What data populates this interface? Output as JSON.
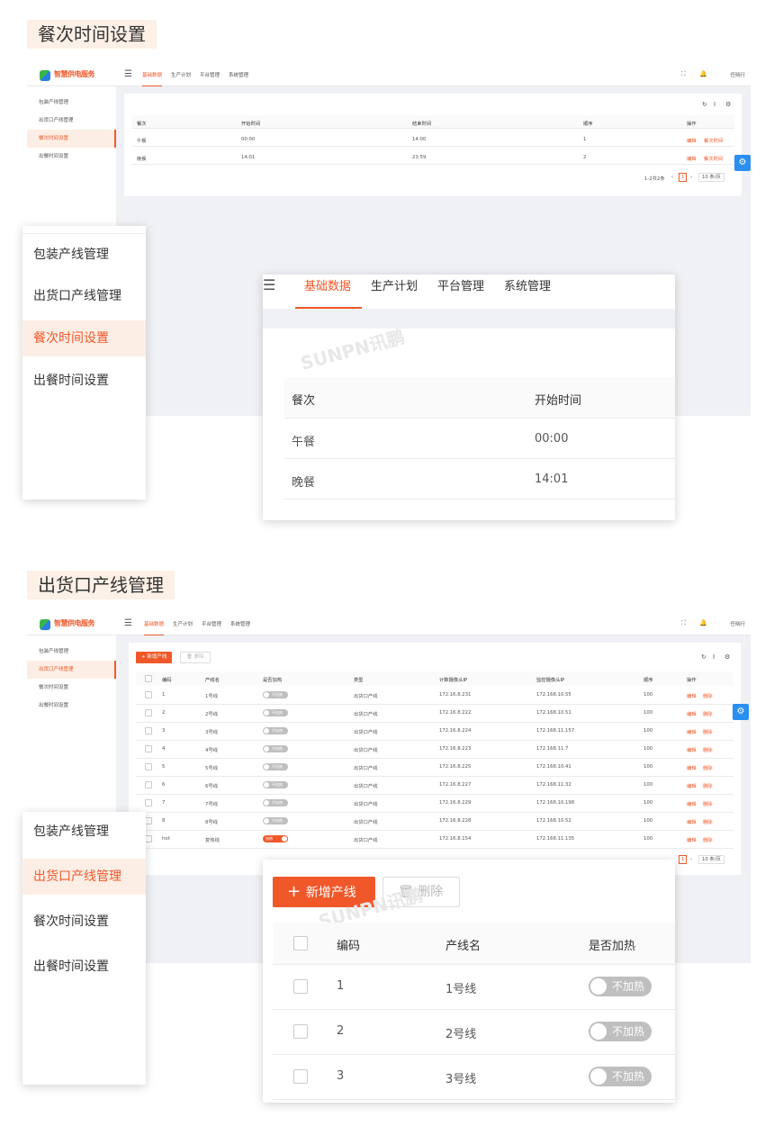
{
  "section1": {
    "title": "餐次时间设置",
    "app": {
      "logo_text": "智慧供电服务",
      "nav": [
        "基础数据",
        "生产计划",
        "平台管理",
        "系统管理"
      ],
      "user": "任晓行",
      "sidebar": [
        "包装产线管理",
        "出货口产线管理",
        "餐次时间设置",
        "出餐时间设置"
      ],
      "table_headers": [
        "餐次",
        "开始时间",
        "结束时间",
        "顺序",
        "操作"
      ],
      "rows": [
        {
          "meal": "午餐",
          "start": "00:00",
          "end": "14:00",
          "order": "1",
          "edit": "编辑",
          "action": "餐次时间"
        },
        {
          "meal": "晚餐",
          "start": "14:01",
          "end": "23:59",
          "order": "2",
          "edit": "编辑",
          "action": "餐次时间"
        }
      ],
      "pagination": {
        "total": "1-2共2条",
        "page": "1",
        "per_page": "10 条/页"
      }
    },
    "zoom_side": [
      "包装产线管理",
      "出货口产线管理",
      "餐次时间设置",
      "出餐时间设置"
    ],
    "zoom_main": {
      "nav": [
        "基础数据",
        "生产计划",
        "平台管理",
        "系统管理"
      ],
      "headers": [
        "餐次",
        "开始时间"
      ],
      "rows": [
        [
          "午餐",
          "00:00"
        ],
        [
          "晚餐",
          "14:01"
        ]
      ],
      "watermark": "SUNPN讯鹏"
    }
  },
  "section2": {
    "title": "出货口产线管理",
    "app": {
      "logo_text": "智慧供电服务",
      "nav": [
        "基础数据",
        "生产计划",
        "平台管理",
        "系统管理"
      ],
      "user": "任晓行",
      "sidebar": [
        "包装产线管理",
        "出货口产线管理",
        "餐次时间设置",
        "出餐时间设置"
      ],
      "add_btn": "新增产线",
      "del_btn": "删除",
      "headers": [
        "编码",
        "产线名",
        "是否加热",
        "类型",
        "计数摄像头IP",
        "监控摄像头IP",
        "顺序",
        "操作"
      ],
      "rows": [
        {
          "code": "1",
          "name": "1号线",
          "heat": "不加热",
          "on": false,
          "type": "出货口产线",
          "cip": "172.16.8.231",
          "mip": "172.168.10.55",
          "order": "100"
        },
        {
          "code": "2",
          "name": "2号线",
          "heat": "不加热",
          "on": false,
          "type": "出货口产线",
          "cip": "172.16.8.222",
          "mip": "172.168.10.51",
          "order": "100"
        },
        {
          "code": "3",
          "name": "3号线",
          "heat": "不加热",
          "on": false,
          "type": "出货口产线",
          "cip": "172.16.8.224",
          "mip": "172.168.11.157",
          "order": "100"
        },
        {
          "code": "4",
          "name": "4号线",
          "heat": "不加热",
          "on": false,
          "type": "出货口产线",
          "cip": "172.16.8.223",
          "mip": "172.168.11.7",
          "order": "100"
        },
        {
          "code": "5",
          "name": "5号线",
          "heat": "不加热",
          "on": false,
          "type": "出货口产线",
          "cip": "172.16.8.225",
          "mip": "172.168.10.41",
          "order": "100"
        },
        {
          "code": "6",
          "name": "6号线",
          "heat": "不加热",
          "on": false,
          "type": "出货口产线",
          "cip": "172.16.8.227",
          "mip": "172.168.11.32",
          "order": "100"
        },
        {
          "code": "7",
          "name": "7号线",
          "heat": "不加热",
          "on": false,
          "type": "出货口产线",
          "cip": "172.16.8.229",
          "mip": "172.168.10.198",
          "order": "100"
        },
        {
          "code": "8",
          "name": "8号线",
          "heat": "不加热",
          "on": false,
          "type": "出货口产线",
          "cip": "172.16.8.228",
          "mip": "172.168.10.52",
          "order": "100"
        },
        {
          "code": "hot",
          "name": "复热线",
          "heat": "加热",
          "on": true,
          "type": "出货口产线",
          "cip": "172.16.8.154",
          "mip": "172.168.11.135",
          "order": "100"
        }
      ],
      "edit": "编辑",
      "delete": "删除",
      "pagination": {
        "page": "1",
        "per_page": "10 条/页"
      }
    },
    "zoom_side": [
      "包装产线管理",
      "出货口产线管理",
      "餐次时间设置",
      "出餐时间设置"
    ],
    "zoom_main": {
      "add_btn": "新增产线",
      "del_btn": "删除",
      "headers": [
        "编码",
        "产线名",
        "是否加热"
      ],
      "rows": [
        [
          "1",
          "1号线",
          "不加热"
        ],
        [
          "2",
          "2号线",
          "不加热"
        ],
        [
          "3",
          "3号线",
          "不加热"
        ]
      ],
      "watermark": "SUNPN讯鹏"
    }
  },
  "colors": {
    "accent": "#f0582a",
    "blue": "#2a8ff0"
  }
}
